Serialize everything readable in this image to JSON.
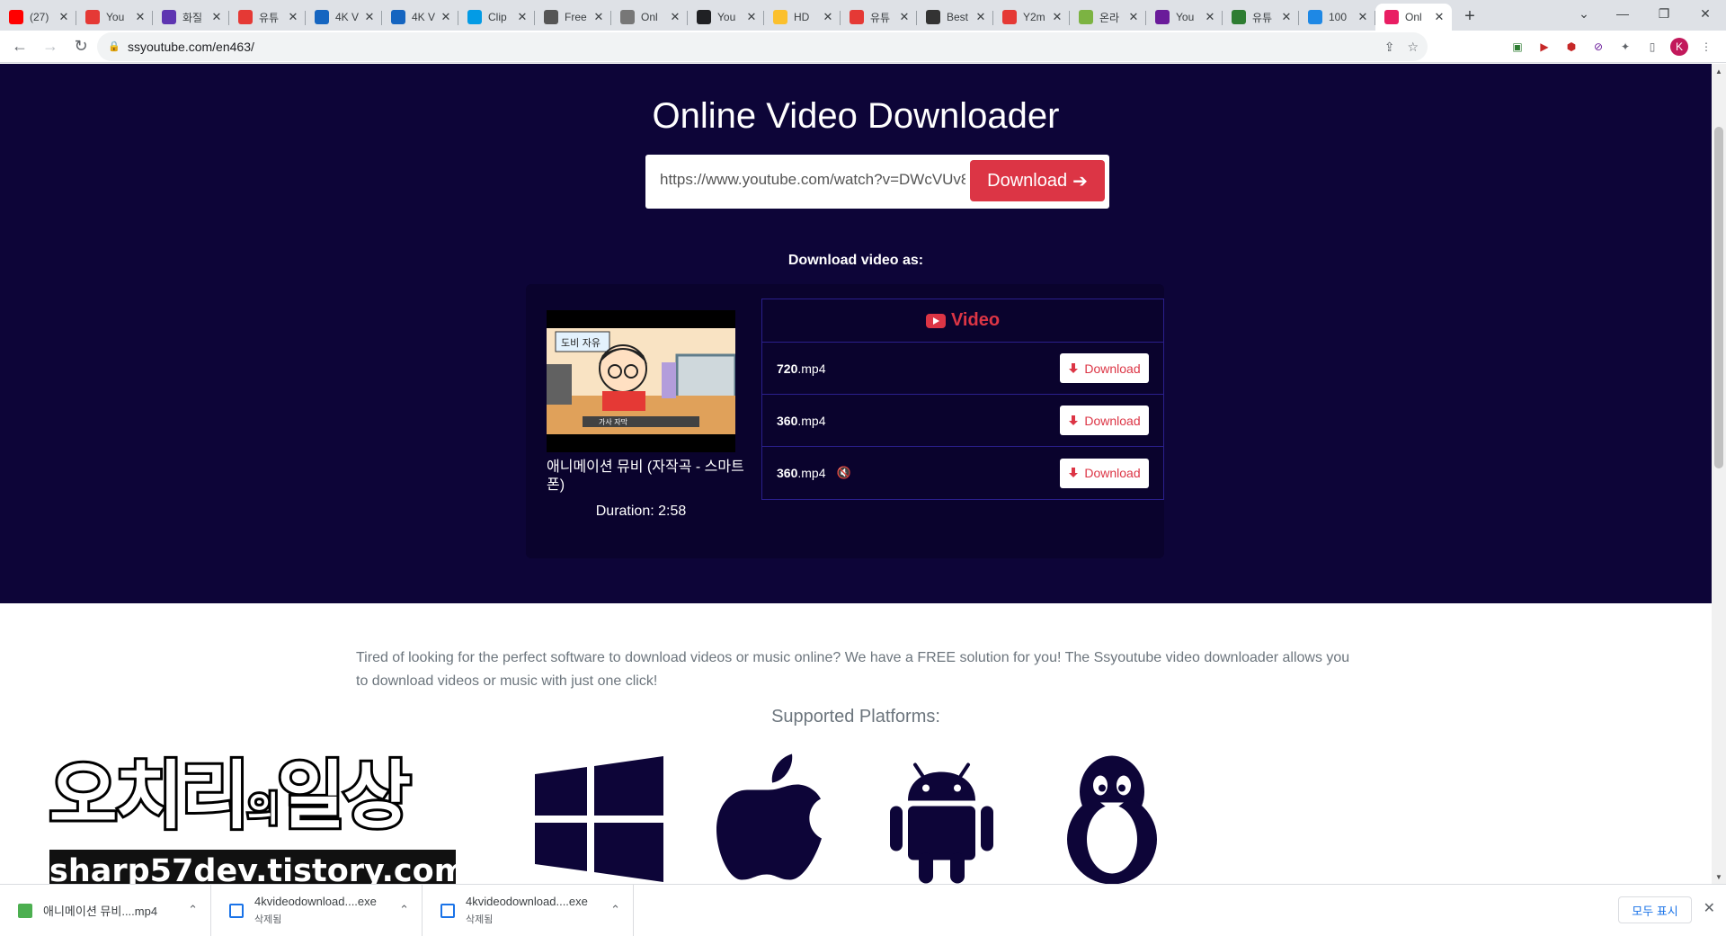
{
  "browser": {
    "tabs": [
      {
        "label": "(27)",
        "color": "#ff0000",
        "active": false
      },
      {
        "label": "You",
        "color": "#e53935",
        "active": false
      },
      {
        "label": "화질",
        "color": "#5e35b1",
        "active": false
      },
      {
        "label": "유튜",
        "color": "#e53935",
        "active": false
      },
      {
        "label": "4K V",
        "color": "#1565c0",
        "active": false
      },
      {
        "label": "4K V",
        "color": "#1565c0",
        "active": false
      },
      {
        "label": "Clip",
        "color": "#039be5",
        "active": false
      },
      {
        "label": "Free",
        "color": "#555555",
        "active": false
      },
      {
        "label": "Onl",
        "color": "#777777",
        "active": false
      },
      {
        "label": "You",
        "color": "#202124",
        "active": false
      },
      {
        "label": "HD",
        "color": "#fbc02d",
        "active": false
      },
      {
        "label": "유튜",
        "color": "#e53935",
        "active": false
      },
      {
        "label": "Best",
        "color": "#333333",
        "active": false
      },
      {
        "label": "Y2m",
        "color": "#e53935",
        "active": false
      },
      {
        "label": "온라",
        "color": "#7cb342",
        "active": false
      },
      {
        "label": "You",
        "color": "#6a1b9a",
        "active": false
      },
      {
        "label": "유튜",
        "color": "#2e7d32",
        "active": false
      },
      {
        "label": "100",
        "color": "#1e88e5",
        "active": false
      },
      {
        "label": "Onl",
        "color": "#e91e63",
        "active": true
      }
    ],
    "url": "ssyoutube.com/en463/",
    "avatar_letter": "K"
  },
  "page": {
    "title": "Online Video Downloader",
    "url_value": "https://www.youtube.com/watch?v=DWcVUv8",
    "download_label": "Download",
    "download_as": "Download video as:",
    "video_title": "애니메이션 뮤비 (자작곡 - 스마트폰)",
    "duration": "Duration: 2:58",
    "section_label": "Video",
    "formats": [
      {
        "quality": "720",
        "ext": ".mp4",
        "muted": false,
        "button": "Download"
      },
      {
        "quality": "360",
        "ext": ".mp4",
        "muted": false,
        "button": "Download"
      },
      {
        "quality": "360",
        "ext": ".mp4",
        "muted": true,
        "button": "Download"
      }
    ],
    "description": "Tired of looking for the perfect software to download videos or music online? We have a FREE solution for you! The Ssyoutube video downloader allows you to download videos or music with just one click!",
    "supported_platforms": "Supported Platforms:",
    "platforms": [
      "windows-icon",
      "apple-icon",
      "android-icon",
      "linux-icon"
    ]
  },
  "watermark": {
    "top_text": "오치리",
    "small_text": "의",
    "top_text2": "일상",
    "bottom_text": "sharp57dev.tistory.com"
  },
  "downloads": {
    "items": [
      {
        "name": "애니메이션 뮤비....mp4",
        "status": ""
      },
      {
        "name": "4kvideodownload....exe",
        "status": "삭제됨"
      },
      {
        "name": "4kvideodownload....exe",
        "status": "삭제됨"
      }
    ],
    "show_all": "모두 표시"
  },
  "colors": {
    "hero_bg": "#0d0538",
    "accent": "#dc3545"
  }
}
